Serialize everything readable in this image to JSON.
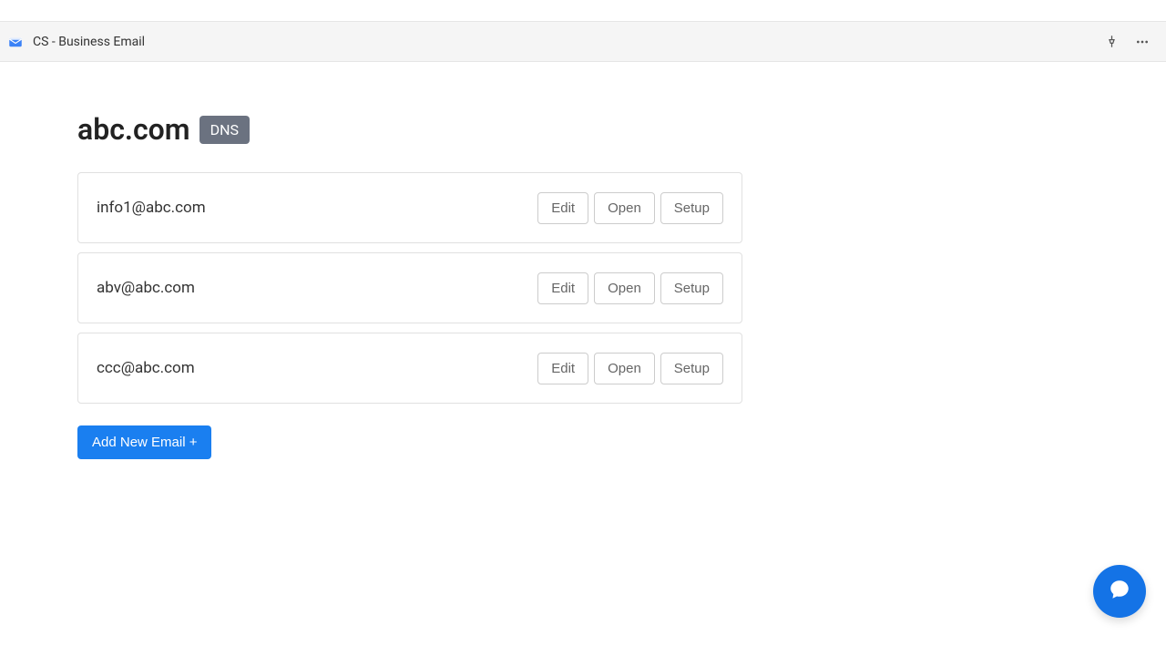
{
  "appbar": {
    "title": "CS - Business Email"
  },
  "page": {
    "domain": "abc.com",
    "dns_label": "DNS"
  },
  "emails": [
    {
      "address": "info1@abc.com"
    },
    {
      "address": "abv@abc.com"
    },
    {
      "address": "ccc@abc.com"
    }
  ],
  "buttons": {
    "edit": "Edit",
    "open": "Open",
    "setup": "Setup",
    "add_new": "Add New Email +"
  }
}
